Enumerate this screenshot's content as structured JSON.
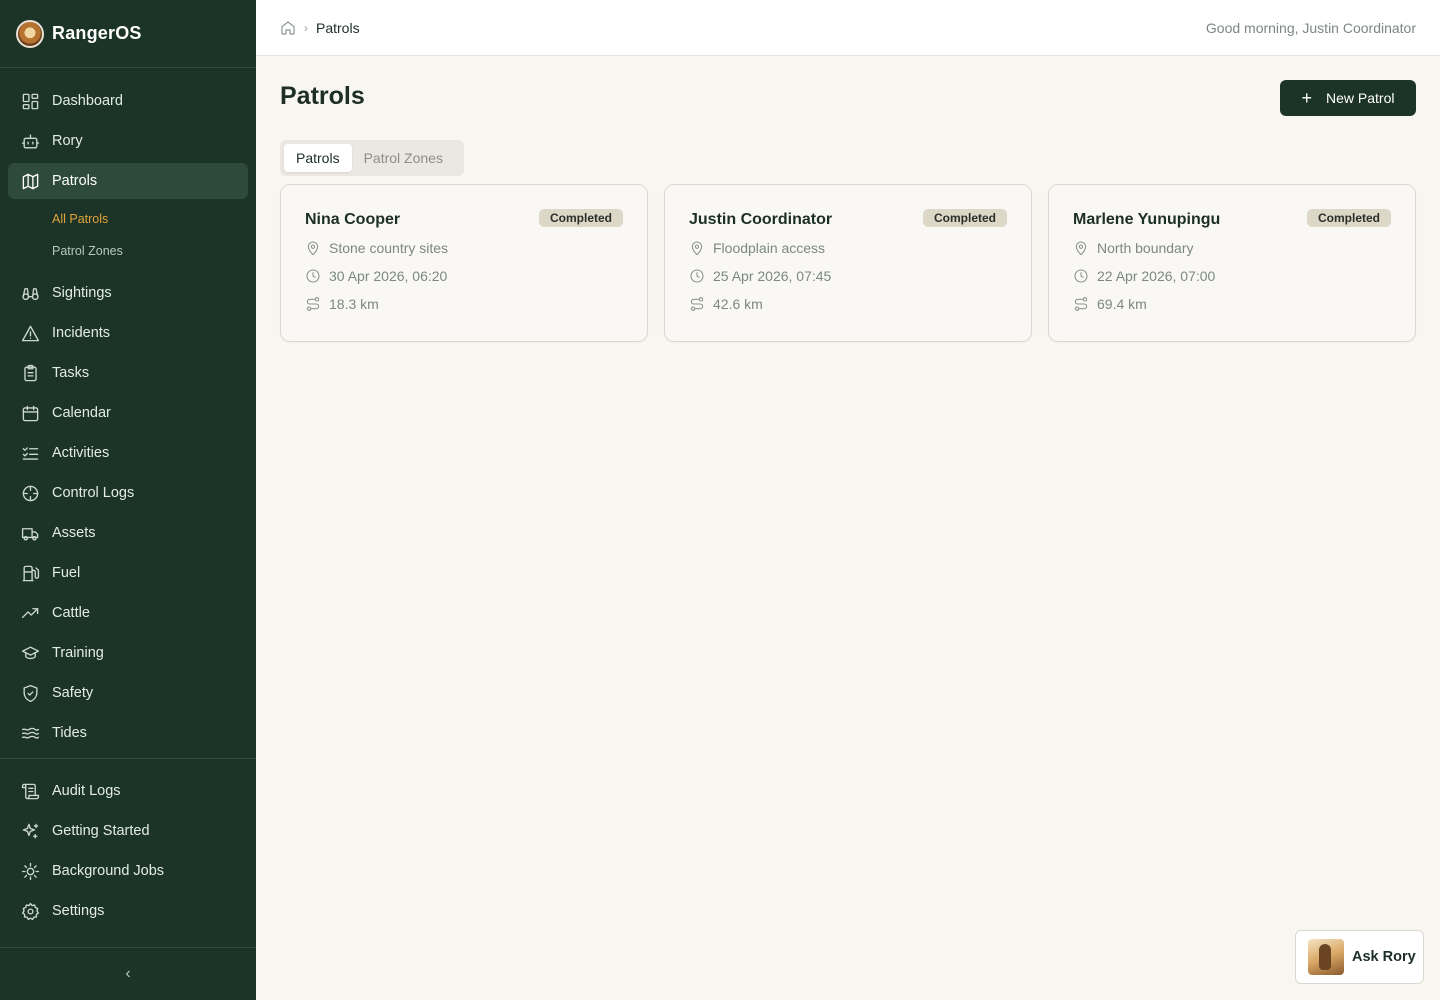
{
  "app": {
    "name": "RangerOS"
  },
  "sidebar": {
    "items": [
      {
        "label": "Dashboard",
        "icon": "dashboard-icon"
      },
      {
        "label": "Rory",
        "icon": "robot-icon"
      },
      {
        "label": "Patrols",
        "icon": "map-icon"
      },
      {
        "label": "Sightings",
        "icon": "binoculars-icon"
      },
      {
        "label": "Incidents",
        "icon": "warning-icon"
      },
      {
        "label": "Tasks",
        "icon": "clipboard-icon"
      },
      {
        "label": "Calendar",
        "icon": "calendar-icon"
      },
      {
        "label": "Activities",
        "icon": "list-checks-icon"
      },
      {
        "label": "Control Logs",
        "icon": "crosshair-icon"
      },
      {
        "label": "Assets",
        "icon": "truck-icon"
      },
      {
        "label": "Fuel",
        "icon": "fuel-icon"
      },
      {
        "label": "Cattle",
        "icon": "trending-up-icon"
      },
      {
        "label": "Training",
        "icon": "graduation-cap-icon"
      },
      {
        "label": "Safety",
        "icon": "shield-check-icon"
      },
      {
        "label": "Tides",
        "icon": "waves-icon"
      }
    ],
    "sub_items": [
      {
        "label": "All Patrols"
      },
      {
        "label": "Patrol Zones"
      }
    ],
    "bottom_items": [
      {
        "label": "Audit Logs",
        "icon": "scroll-icon"
      },
      {
        "label": "Getting Started",
        "icon": "sparkles-icon"
      },
      {
        "label": "Background Jobs",
        "icon": "cog-icon"
      },
      {
        "label": "Settings",
        "icon": "settings-icon"
      }
    ],
    "collapse_glyph": "‹"
  },
  "topbar": {
    "breadcrumb": "Patrols",
    "greeting": "Good morning, Justin Coordinator"
  },
  "main": {
    "title": "Patrols",
    "new_button": "New Patrol",
    "tabs": [
      {
        "label": "Patrols",
        "active": true
      },
      {
        "label": "Patrol Zones",
        "active": false
      }
    ],
    "cards": [
      {
        "name": "Nina Cooper",
        "status": "Completed",
        "zone": "Stone country sites",
        "datetime": "30 Apr 2026, 06:20",
        "distance": "18.3 km"
      },
      {
        "name": "Justin Coordinator",
        "status": "Completed",
        "zone": "Floodplain access",
        "datetime": "25 Apr 2026, 07:45",
        "distance": "42.6 km"
      },
      {
        "name": "Marlene Yunupingu",
        "status": "Completed",
        "zone": "North boundary",
        "datetime": "22 Apr 2026, 07:00",
        "distance": "69.4 km"
      }
    ]
  },
  "assistant": {
    "label": "Ask Rory"
  },
  "colors": {
    "sidebar_bg": "#1c3428",
    "accent": "#e0a23a",
    "page_bg": "#f8f6f1",
    "badge_bg": "#ddd7c7"
  }
}
